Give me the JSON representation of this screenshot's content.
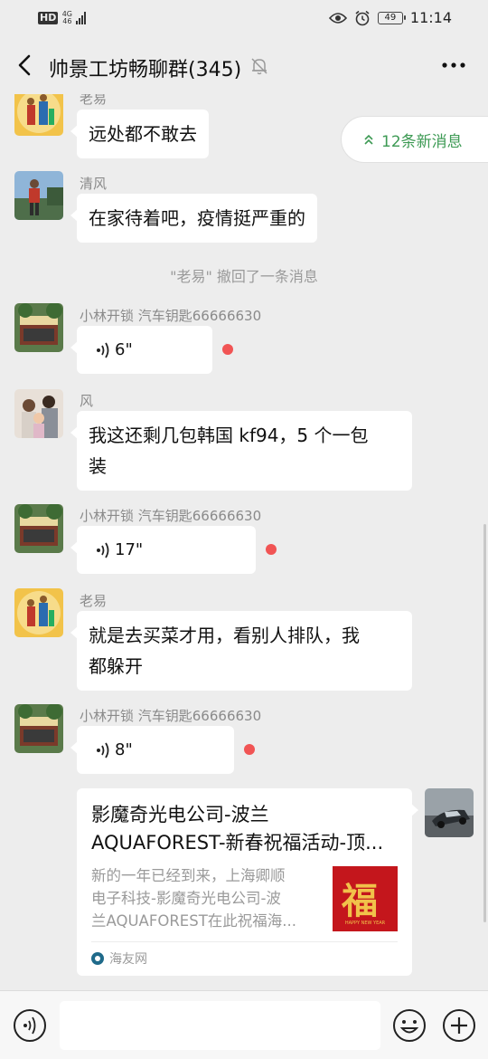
{
  "status": {
    "hd": "HD",
    "net_top": "4G",
    "net_bottom": "46",
    "battery": "49",
    "time": "11:14"
  },
  "header": {
    "title": "帅景工坊畅聊群(345)"
  },
  "new_messages": {
    "label": "12条新消息"
  },
  "system": {
    "recall_notice": "\"老易\" 撤回了一条消息"
  },
  "messages": [
    {
      "sender": "老易",
      "text": "远处都不敢去"
    },
    {
      "sender": "清风",
      "text": "在家待着吧，疫情挺严重的"
    },
    {
      "sender": "小林开锁 汽车钥匙66666630",
      "voice": "6\""
    },
    {
      "sender": "风",
      "text_line1": "我这还剩几包韩国 kf94，5 个一包",
      "text_line2": "装"
    },
    {
      "sender": "小林开锁 汽车钥匙66666630",
      "voice": "17\""
    },
    {
      "sender": "老易",
      "text_line1": "就是去买菜才用，看别人排队，我",
      "text_line2": "都躲开"
    },
    {
      "sender": "小林开锁 汽车钥匙66666630",
      "voice": "8\""
    }
  ],
  "link_card": {
    "title_line1": "影魔奇光电公司-波兰",
    "title_line2": "AQUAFOREST-新春祝福活动-顶...",
    "desc_line1": "新的一年已经到来，上海卿顺",
    "desc_line2": "电子科技-影魔奇光电公司-波",
    "desc_line3": "兰AQUAFOREST在此祝福海...",
    "thumb_char": "福",
    "thumb_caption": "HAPPY NEW YEAR",
    "source": "海友网"
  },
  "input": {
    "placeholder": ""
  },
  "colors": {
    "background": "#ededed",
    "bubble": "#ffffff",
    "accent_green": "#3d9a54",
    "unread_dot": "#f15454"
  }
}
